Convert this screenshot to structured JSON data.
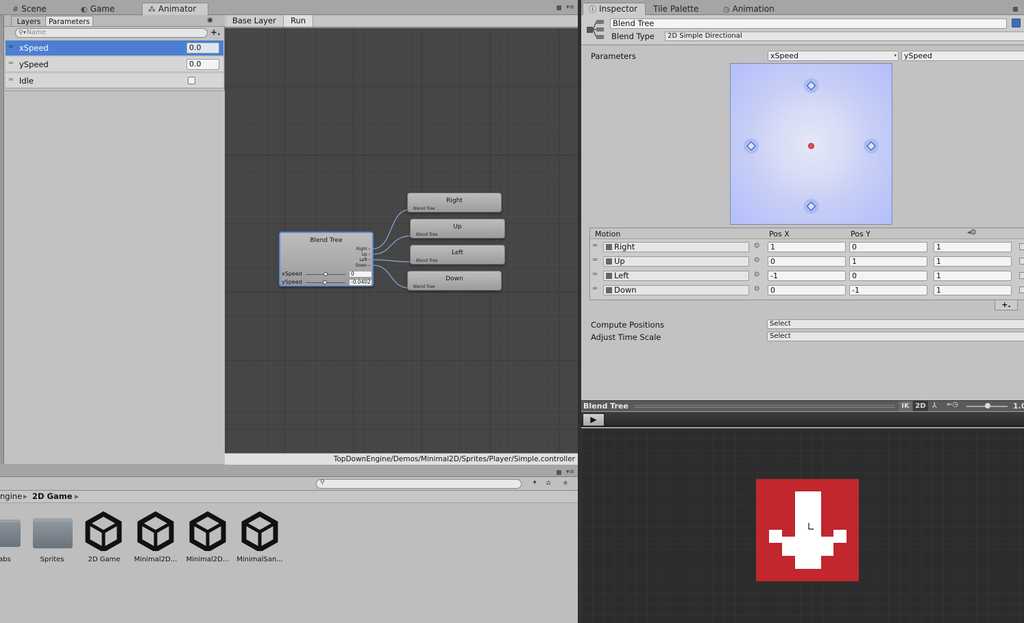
{
  "editor_tabs": {
    "left": [
      {
        "label": "Scene",
        "icon": "#"
      },
      {
        "label": "Game",
        "icon": "◐"
      },
      {
        "label": "Animator",
        "icon": "⁂"
      }
    ],
    "right": [
      {
        "label": "Inspector",
        "icon": "ⓘ"
      },
      {
        "label": "Tile Palette",
        "icon": ""
      },
      {
        "label": "Animation",
        "icon": "◷"
      }
    ]
  },
  "animator": {
    "subtabs": {
      "layers": "Layers",
      "parameters": "Parameters"
    },
    "search_placeholder": "Name",
    "add_glyph": "+.",
    "parameters": [
      {
        "name": "xSpeed",
        "type": "float",
        "value": "0.0",
        "selected": true
      },
      {
        "name": "ySpeed",
        "type": "float",
        "value": "0.0",
        "selected": false
      },
      {
        "name": "Idle",
        "type": "bool",
        "value": "",
        "selected": false
      }
    ],
    "breadcrumb": [
      "Base Layer",
      "Run"
    ],
    "path": "TopDownEngine/Demos/Minimal2D/Sprites/Player/Simple.controller",
    "blend_node": {
      "title": "Blend Tree",
      "ports": [
        "Right",
        "Up",
        "Left",
        "Down"
      ],
      "params": [
        {
          "name": "xSpeed",
          "value": "0",
          "slider": 0.5
        },
        {
          "name": "ySpeed",
          "value": "-0.0402",
          "slider": 0.49
        }
      ]
    },
    "children": [
      {
        "name": "Right",
        "sub": "Blend Tree"
      },
      {
        "name": "Up",
        "sub": "Blend Tree"
      },
      {
        "name": "Left",
        "sub": "Blend Tree"
      },
      {
        "name": "Down",
        "sub": "Blend Tree"
      }
    ]
  },
  "project": {
    "breadcrumb": [
      "ngine",
      "2D Game"
    ],
    "assets": [
      {
        "label": "abs",
        "kind": "folder"
      },
      {
        "label": "Sprites",
        "kind": "folder"
      },
      {
        "label": "2D Game",
        "kind": "unity"
      },
      {
        "label": "Minimal2D...",
        "kind": "unity"
      },
      {
        "label": "Minimal2D...",
        "kind": "unity"
      },
      {
        "label": "MinimalSan...",
        "kind": "unity"
      }
    ]
  },
  "inspector": {
    "name": "Blend Tree",
    "blend_type_label": "Blend Type",
    "blend_type": "2D Simple Directional",
    "parameters_label": "Parameters",
    "param_x": "xSpeed",
    "param_y": "ySpeed",
    "motion_headers": [
      "Motion",
      "Pos X",
      "Pos Y"
    ],
    "motions": [
      {
        "name": "Right",
        "pos_x": "1",
        "pos_y": "0",
        "speed": "1"
      },
      {
        "name": "Up",
        "pos_x": "0",
        "pos_y": "1",
        "speed": "1"
      },
      {
        "name": "Left",
        "pos_x": "-1",
        "pos_y": "0",
        "speed": "1"
      },
      {
        "name": "Down",
        "pos_x": "0",
        "pos_y": "-1",
        "speed": "1"
      }
    ],
    "add_glyph": "+.",
    "compute_positions_label": "Compute Positions",
    "compute_positions": "Select",
    "adjust_time_label": "Adjust Time Scale",
    "adjust_time": "Select"
  },
  "preview": {
    "title": "Blend Tree",
    "buttons": [
      "IK",
      "2D"
    ],
    "speed_value": "1.0",
    "sprite_color": "#c1272d"
  },
  "colors": {
    "selection": "#4c7fd3",
    "accent_blue": "#5a8ad8"
  }
}
